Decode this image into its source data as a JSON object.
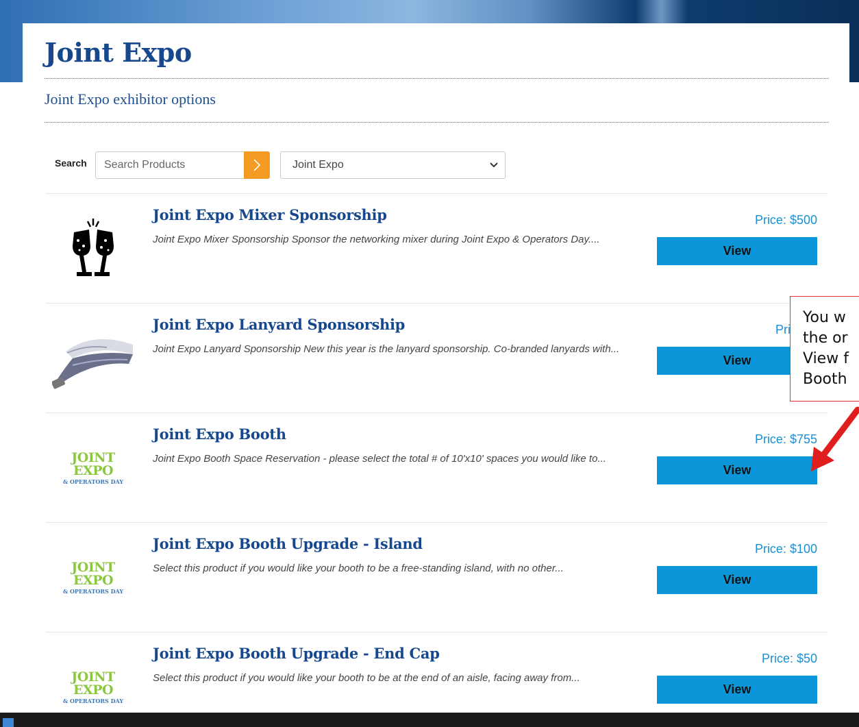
{
  "page": {
    "title": "Joint Expo",
    "subtitle": "Joint Expo exhibitor options"
  },
  "search": {
    "label": "Search",
    "placeholder": "Search Products",
    "category_selected": "Joint Expo"
  },
  "products": [
    {
      "title": "Joint Expo Mixer Sponsorship",
      "desc": "Joint Expo Mixer Sponsorship Sponsor the networking mixer during Joint Expo & Operators Day....",
      "price": "Price: $500",
      "view_label": "View",
      "image": "champagne-glasses-icon"
    },
    {
      "title": "Joint Expo Lanyard Sponsorship",
      "desc": "Joint Expo Lanyard Sponsorship New this year is the lanyard sponsorship. Co-branded lanyards with...",
      "price": "Price: $",
      "view_label": "View",
      "image": "lanyard-image"
    },
    {
      "title": "Joint Expo Booth",
      "desc": "Joint Expo Booth Space Reservation - please select the total # of 10'x10' spaces you would like to...",
      "price": "Price: $755",
      "view_label": "View",
      "image": "joint-expo-logo",
      "logo_line1": "JOINT EXPO",
      "logo_line2": "& OPERATORS DAY"
    },
    {
      "title": "Joint Expo Booth Upgrade - Island",
      "desc": "Select this product if you would like your booth to be a free-standing island, with no other...",
      "price": "Price: $100",
      "view_label": "View",
      "image": "joint-expo-logo",
      "logo_line1": "JOINT EXPO",
      "logo_line2": "& OPERATORS DAY"
    },
    {
      "title": "Joint Expo Booth Upgrade - End Cap",
      "desc": "Select this product if you would like your booth to be at the end of an aisle, facing away from...",
      "price": "Price: $50",
      "view_label": "View",
      "image": "joint-expo-logo",
      "logo_line1": "JOINT EXPO",
      "logo_line2": "& OPERATORS DAY"
    }
  ],
  "callout": {
    "line1": "You w",
    "line2": "the or",
    "line3": "View f",
    "line4": "Booth"
  },
  "colors": {
    "title_blue": "#17478c",
    "price_blue": "#1a8fd6",
    "view_button": "#0a96d8",
    "search_button": "#f59a23",
    "logo_green": "#8dc63f",
    "callout_red": "#e03131"
  }
}
